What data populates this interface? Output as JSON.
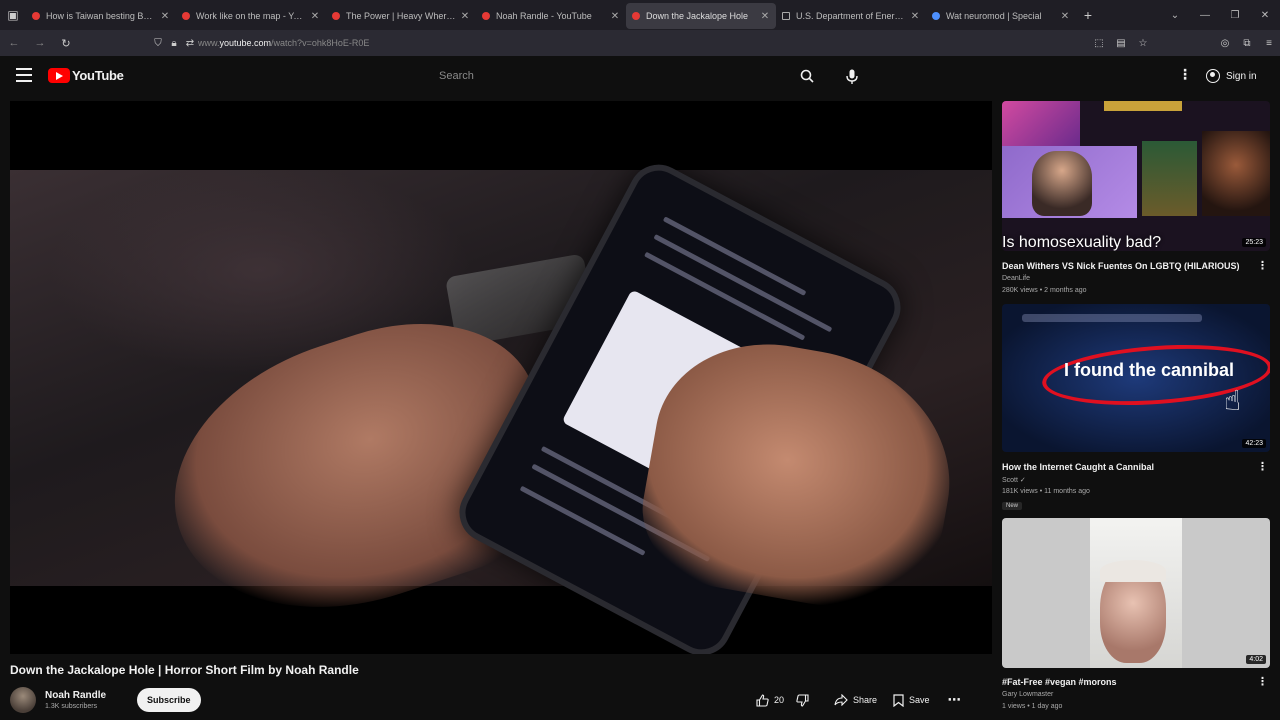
{
  "browser": {
    "tabs": [
      {
        "title": "How is Taiwan besting Beijing...",
        "icon": "youtube-favicon"
      },
      {
        "title": "Work like on the map - YouTube",
        "icon": "youtube-favicon"
      },
      {
        "title": "The Power | Heavy Whereby stru",
        "icon": "youtube-favicon"
      },
      {
        "title": "Noah Randle - YouTube",
        "icon": "youtube-favicon"
      },
      {
        "title": "Down the Jackalope Hole",
        "icon": "youtube-favicon"
      },
      {
        "title": "U.S. Department of Energy on",
        "icon": "doc-favicon"
      },
      {
        "title": "Wat neuromod | Special",
        "icon": "chrome-favicon"
      }
    ],
    "url_host": "youtube.com",
    "url_prefix": "www.",
    "url_path": "/watch?v=ohk8HoE-R0E"
  },
  "masthead": {
    "logo_text": "YouTube",
    "search_placeholder": "Search",
    "sign_in": "Sign in"
  },
  "video": {
    "title": "Down the Jackalope Hole | Horror Short Film by Noah Randle",
    "channel_name": "Noah Randle",
    "channel_subs": "1.3K subscribers",
    "subscribe_label": "Subscribe",
    "like_count": "20",
    "share_label": "Share",
    "save_label": "Save"
  },
  "related": [
    {
      "thumb_text": "Is homosexuality bad?",
      "banner_text": "...",
      "duration": "25:23",
      "title": "Dean Withers VS Nick Fuentes On LGBTQ (HILARIOUS)",
      "channel": "DeanLife",
      "meta": "280K views • 2 months ago"
    },
    {
      "thumb_text": "I found the cannibal",
      "duration": "42:23",
      "title": "How the Internet Caught a Cannibal",
      "channel": "Scott ✓",
      "meta": "181K views • 11 months ago",
      "badge": "New"
    },
    {
      "duration": "4:02",
      "title": "#Fat-Free #vegan #morons",
      "channel": "Gary Lowmaster",
      "meta": "1 views • 1 day ago"
    }
  ]
}
